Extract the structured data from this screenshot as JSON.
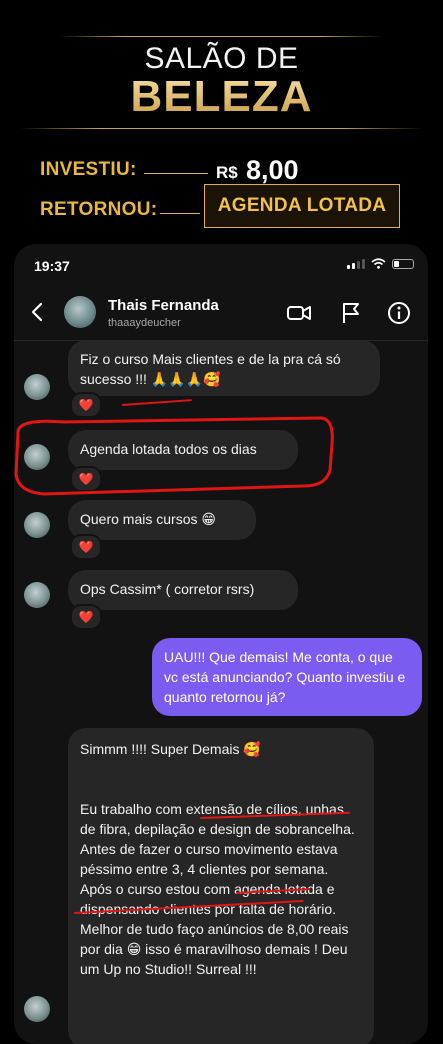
{
  "promo": {
    "title_top": "SALÃO DE",
    "title_main": "BELEZA",
    "invested_label": "INVESTIU:",
    "invested_currency": "R$",
    "invested_value": "8,00",
    "returned_label": "RETORNOU:",
    "returned_value": "AGENDA LOTADA",
    "accent_color": "#e9b83c"
  },
  "status_bar": {
    "time": "19:37"
  },
  "chat_header": {
    "name": "Thais Fernanda",
    "username": "thaaaydeucher",
    "icons": [
      "back-arrow-icon",
      "video-call-icon",
      "flag-icon",
      "info-icon"
    ]
  },
  "messages": [
    {
      "from": "them",
      "text": "Fiz o curso Mais clientes e de la pra cá só sucesso !!! 🙏🙏🙏🥰",
      "reaction": "❤️"
    },
    {
      "from": "them",
      "text": "Agenda lotada todos os dias",
      "reaction": "❤️"
    },
    {
      "from": "them",
      "text": "Quero mais cursos 😁",
      "reaction": "❤️"
    },
    {
      "from": "them",
      "text": "Ops Cassim* ( corretor rsrs)",
      "reaction": "❤️"
    },
    {
      "from": "me",
      "text": "UAU!!! Que demais! Me conta, o que vc está anunciando? Quanto investiu e quanto retornou já?"
    },
    {
      "from": "them",
      "text": "Simmm !!!! Super Demais 🥰\n\n\nEu trabalho com extensão de cílios, unhas de fibra, depilação e design de sobrancelha. Antes de fazer o curso movimento estava péssimo entre 3, 4 clientes por semana. Após o curso estou com agenda lotada e dispensando clientes por falta de horário. Melhor de tudo faço anúncios de 8,00 reais por dia 😁 isso é maravilhoso demais ! Deu um Up no Studio!! Surreal !!!"
    }
  ],
  "colors": {
    "my_bubble": "#7b5cf0",
    "their_bubble": "#262626",
    "annotation_red": "#e01616"
  }
}
